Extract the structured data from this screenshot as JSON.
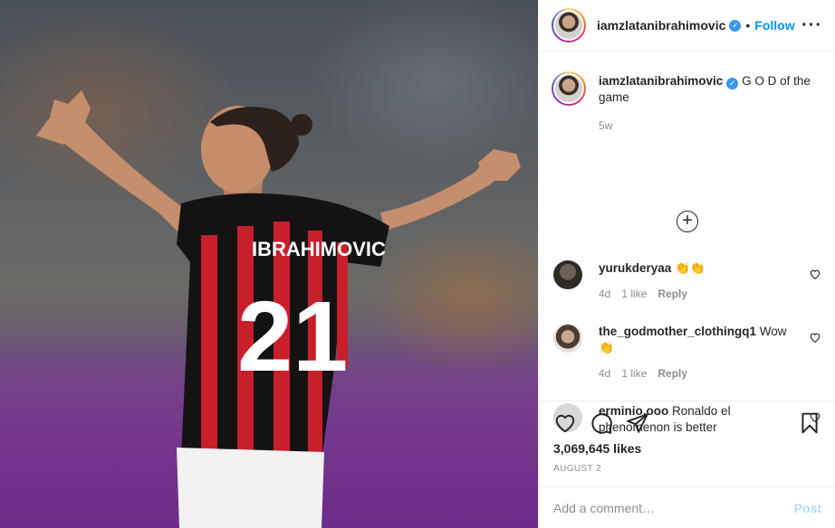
{
  "post": {
    "image_alt": "Player in red and black striped number 21 jersey with arms outstretched",
    "jersey_name": "IBRAHIMOVIC",
    "jersey_number": "21"
  },
  "header": {
    "username": "iamzlatanibrahimovic",
    "verified_mark": "✓",
    "separator": "•",
    "follow_label": "Follow",
    "more_label": "···"
  },
  "caption": {
    "username": "iamzlatanibrahimovic",
    "verified_mark": "✓",
    "text": "G O D of the game",
    "time": "5w"
  },
  "load_more_label": "+",
  "comments": [
    {
      "username": "yurukderyaa",
      "text": "👏👏",
      "time": "4d",
      "likes": "1 like",
      "reply": "Reply",
      "avatar_color": "#3d3a32"
    },
    {
      "username": "the_godmother_clothingq1",
      "text": "Wow 👏",
      "time": "4d",
      "likes": "1 like",
      "reply": "Reply",
      "avatar_color": "#6b5a4e"
    },
    {
      "username": "erminio.ooo",
      "text": "Ronaldo el phenomenon is better",
      "time": "",
      "likes": "",
      "reply": "",
      "avatar_color": "#cfcfcf"
    }
  ],
  "actions": {
    "likes_count": "3,069,645 likes",
    "date": "AUGUST 2",
    "icons": [
      "heart-icon",
      "comment-icon",
      "share-icon",
      "bookmark-icon"
    ]
  },
  "add_comment": {
    "placeholder": "Add a comment…",
    "post_label": "Post"
  },
  "colors": {
    "accent": "#0095f6",
    "verified": "#3897f0",
    "post_disabled": "#b3dbff",
    "muted": "#8e8e8e"
  }
}
